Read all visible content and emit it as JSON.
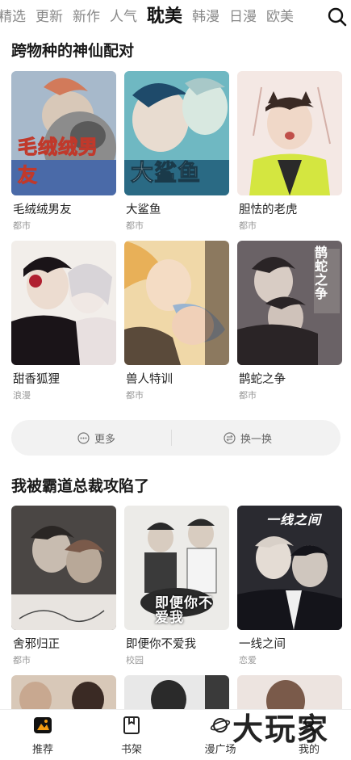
{
  "top_tabs": [
    "精选",
    "更新",
    "新作",
    "人气",
    "耽美",
    "韩漫",
    "日漫",
    "欧美"
  ],
  "active_tab": "耽美",
  "sections": [
    {
      "title": "跨物种的神仙配对",
      "cards": [
        {
          "title": "毛绒绒男友",
          "tag": "都市",
          "cover_text": "毛绒绒男友",
          "colors": [
            "#8aa0b8",
            "#d27a5a",
            "#c8b8a0"
          ]
        },
        {
          "title": "大鲨鱼",
          "tag": "都市",
          "cover_text": "大鲨鱼",
          "colors": [
            "#3a8fa0",
            "#7ab8c8",
            "#d8e8e0"
          ]
        },
        {
          "title": "胆怯的老虎",
          "tag": "都市",
          "cover_text": "",
          "colors": [
            "#f2e6e2",
            "#3a2a24",
            "#d4e640"
          ]
        },
        {
          "title": "甜香狐狸",
          "tag": "浪漫",
          "cover_text": "",
          "colors": [
            "#f0ece8",
            "#1a1418",
            "#b02030"
          ]
        },
        {
          "title": "兽人特训",
          "tag": "都市",
          "cover_text": "",
          "colors": [
            "#e8b058",
            "#9ab4d0",
            "#5a4a3a"
          ]
        },
        {
          "title": "鹊蛇之争",
          "tag": "都市",
          "cover_text": "鹊蛇之争",
          "colors": [
            "#4a4244",
            "#2a2426",
            "#8a7a78"
          ]
        }
      ]
    },
    {
      "title": "我被霸道总裁攻陷了",
      "cards": [
        {
          "title": "舍邪归正",
          "tag": "都市",
          "cover_text": "",
          "colors": [
            "#3a3836",
            "#c8bcb0",
            "#7a5a4a"
          ]
        },
        {
          "title": "即便你不爱我",
          "tag": "校园",
          "cover_text": "即便你不爱我",
          "colors": [
            "#e8e8e6",
            "#2a2a2a",
            "#9a9a98"
          ]
        },
        {
          "title": "一线之间",
          "tag": "恋爱",
          "cover_text": "一线之间",
          "colors": [
            "#2a2a30",
            "#d8d0c8",
            "#5a6070"
          ]
        }
      ]
    }
  ],
  "more_button": "更多",
  "refresh_button": "换一换",
  "bottom_nav": [
    {
      "label": "推荐",
      "icon": "recommend-icon"
    },
    {
      "label": "书架",
      "icon": "bookshelf-icon"
    },
    {
      "label": "漫广场",
      "icon": "planet-icon"
    },
    {
      "label": "我的",
      "icon": "profile-icon"
    }
  ],
  "watermark": "大玩家"
}
